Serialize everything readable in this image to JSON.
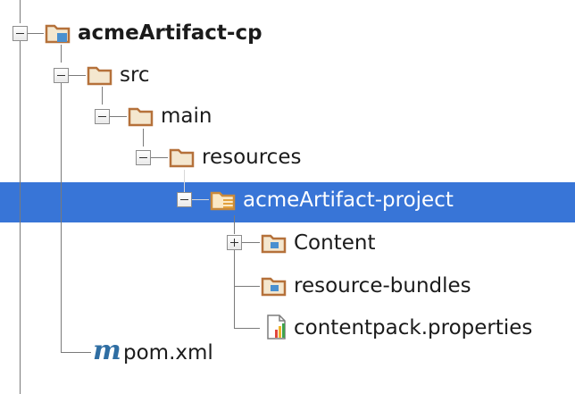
{
  "tree": {
    "root": {
      "label": "acmeArtifact-cp"
    },
    "src": {
      "label": "src"
    },
    "main": {
      "label": "main"
    },
    "resources": {
      "label": "resources"
    },
    "project": {
      "label": "acmeArtifact-project",
      "selected": true
    },
    "content": {
      "label": "Content"
    },
    "bundles": {
      "label": "resource-bundles"
    },
    "props": {
      "label": "contentpack.properties"
    },
    "pom": {
      "label": "pom.xml",
      "icon_glyph": "m"
    }
  },
  "colors": {
    "selection": "#3875d7",
    "folder": "#b5713a",
    "module_marker": "#4a90d0",
    "maven": "#2f6ea3"
  },
  "icons": {
    "folder": "folder-icon",
    "module_folder": "module-folder-icon",
    "resource_folder": "resource-folder-icon",
    "properties_file": "properties-file-icon",
    "maven": "maven-icon"
  }
}
